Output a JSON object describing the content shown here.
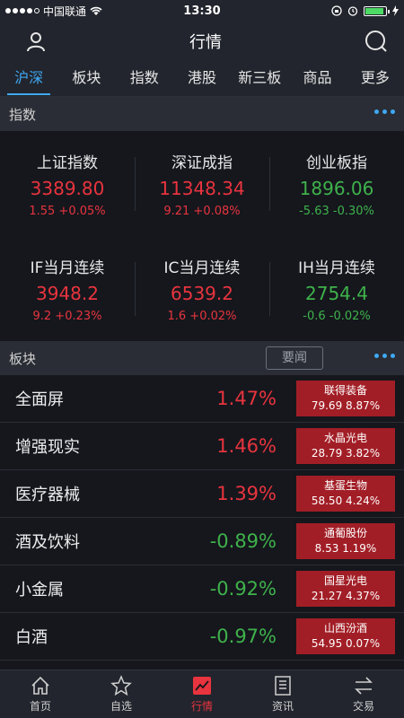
{
  "status_bar": {
    "carrier": "中国联通",
    "time": "13:30"
  },
  "nav": {
    "title": "行情"
  },
  "tabs": [
    {
      "label": "沪深"
    },
    {
      "label": "板块"
    },
    {
      "label": "指数"
    },
    {
      "label": "港股"
    },
    {
      "label": "新三板"
    },
    {
      "label": "商品"
    },
    {
      "label": "更多"
    }
  ],
  "index_section": {
    "title": "指数",
    "items": [
      {
        "name": "上证指数",
        "value": "3389.80",
        "change": "1.55 +0.05%"
      },
      {
        "name": "深证成指",
        "value": "11348.34",
        "change": "9.21 +0.08%"
      },
      {
        "name": "创业板指",
        "value": "1896.06",
        "change": "-5.63 -0.30%"
      },
      {
        "name": "IF当月连续",
        "value": "3948.2",
        "change": "9.2 +0.23%"
      },
      {
        "name": "IC当月连续",
        "value": "6539.2",
        "change": "1.6 +0.02%"
      },
      {
        "name": "IH当月连续",
        "value": "2754.4",
        "change": "-0.6 -0.02%"
      }
    ]
  },
  "sector_section": {
    "title": "板块",
    "news_label": "要闻",
    "items": [
      {
        "name": "全面屏",
        "pct": "1.47%",
        "stock": "联得装备",
        "stock_info": "79.69 8.87%"
      },
      {
        "name": "增强现实",
        "pct": "1.46%",
        "stock": "水晶光电",
        "stock_info": "28.79 3.82%"
      },
      {
        "name": "医疗器械",
        "pct": "1.39%",
        "stock": "基蛋生物",
        "stock_info": "58.50 4.24%"
      },
      {
        "name": "酒及饮料",
        "pct": "-0.89%",
        "stock": "通葡股份",
        "stock_info": "8.53 1.19%"
      },
      {
        "name": "小金属",
        "pct": "-0.92%",
        "stock": "国星光电",
        "stock_info": "21.27 4.37%"
      },
      {
        "name": "白酒",
        "pct": "-0.97%",
        "stock": "山西汾酒",
        "stock_info": "54.95 0.07%"
      }
    ]
  },
  "tab_bar": [
    {
      "label": "首页",
      "icon": "home-icon"
    },
    {
      "label": "自选",
      "icon": "star-icon"
    },
    {
      "label": "行情",
      "icon": "chart-icon"
    },
    {
      "label": "资讯",
      "icon": "document-icon"
    },
    {
      "label": "交易",
      "icon": "transfer-icon"
    }
  ],
  "colors": {
    "up": "#e8343e",
    "down": "#3fb24b",
    "accent": "#3fa9f5",
    "stock_box": "#a21e26"
  }
}
